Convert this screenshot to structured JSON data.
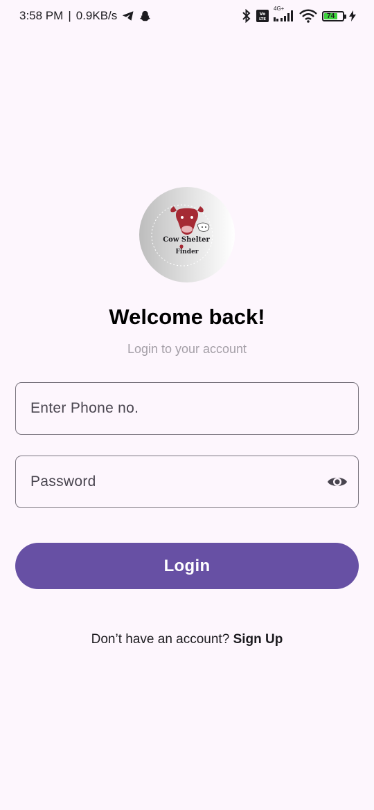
{
  "status_bar": {
    "time": "3:58 PM",
    "separator": "|",
    "speed": "0.9KB/s",
    "network_label": "4G+",
    "volte_label": "Vo LTE",
    "battery_level": "74",
    "left_icons": [
      "telegram-icon",
      "snapchat-icon"
    ],
    "right_icons": [
      "bluetooth-icon",
      "volte-icon",
      "signal-icon",
      "wifi-icon",
      "battery-icon",
      "charging-icon"
    ]
  },
  "logo": {
    "line1": "Cow Shelter",
    "line2": "Finder",
    "brand_color": "#a52a34"
  },
  "header": {
    "title": "Welcome back!",
    "subtitle": "Login to your account"
  },
  "form": {
    "phone_placeholder": "Enter Phone no.",
    "phone_value": "",
    "password_placeholder": "Password",
    "password_value": "",
    "password_toggle_icon": "eye-icon"
  },
  "actions": {
    "login_label": "Login",
    "signup_prompt": "Don’t have an account?",
    "signup_label": "Sign Up"
  },
  "colors": {
    "background": "#fdf6fd",
    "primary": "#6750a4",
    "outline": "#79747e",
    "subtitle": "#a49fa7"
  }
}
